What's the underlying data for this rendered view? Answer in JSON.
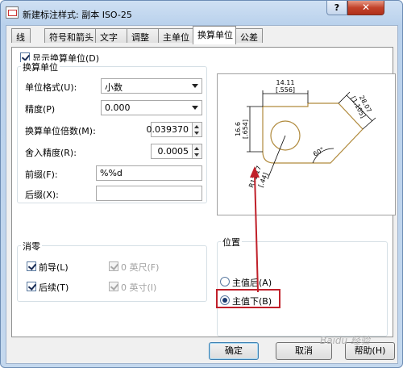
{
  "window": {
    "title": "新建标注样式: 副本 ISO-25",
    "help_label": "?",
    "close_label": "✕"
  },
  "tabs": [
    {
      "label": "线"
    },
    {
      "label": "符号和箭头"
    },
    {
      "label": "文字"
    },
    {
      "label": "调整"
    },
    {
      "label": "主单位"
    },
    {
      "label": "换算单位"
    },
    {
      "label": "公差"
    }
  ],
  "alt_units": {
    "display_checkbox_label": "显示换算单位(D)",
    "display_checked": true,
    "group_title": "换算单位",
    "unit_format_label": "单位格式(U):",
    "unit_format_value": "小数",
    "precision_label": "精度(P)",
    "precision_value": "0.000",
    "multiplier_label": "换算单位倍数(M):",
    "multiplier_value": "0.039370",
    "round_label": "舍入精度(R):",
    "round_value": "0.0005",
    "prefix_label": "前缀(F):",
    "prefix_value": "%%d",
    "suffix_label": "后缀(X):",
    "suffix_value": ""
  },
  "zero_suppression": {
    "group_title": "消零",
    "leading_label": "前导(L)",
    "leading_checked": true,
    "trailing_label": "后续(T)",
    "trailing_checked": true,
    "feet_label": "0 英尺(F)",
    "feet_checked": true,
    "inches_label": "0 英寸(I)",
    "inches_checked": true
  },
  "placement": {
    "group_title": "位置",
    "after_primary_label": "主值后(A)",
    "below_primary_label": "主值下(B)",
    "selected": "below"
  },
  "preview": {
    "dim_top": "14.11",
    "dim_top_alt": "[.556]",
    "dim_left": "16.6",
    "dim_left_alt": "[.654]",
    "dim_right": "28.07",
    "dim_right_alt": "[1.105]",
    "angle": "60°",
    "dim_radius": "R11.17",
    "dim_radius_alt": "[.44]"
  },
  "buttons": {
    "ok": "确定",
    "cancel": "取消",
    "help": "帮助(H)"
  },
  "watermark": "Baidu 经验",
  "colors": {
    "highlight_box": "#c0202a",
    "arrow": "#c0202a",
    "preview_outline": "#b08a3c"
  }
}
